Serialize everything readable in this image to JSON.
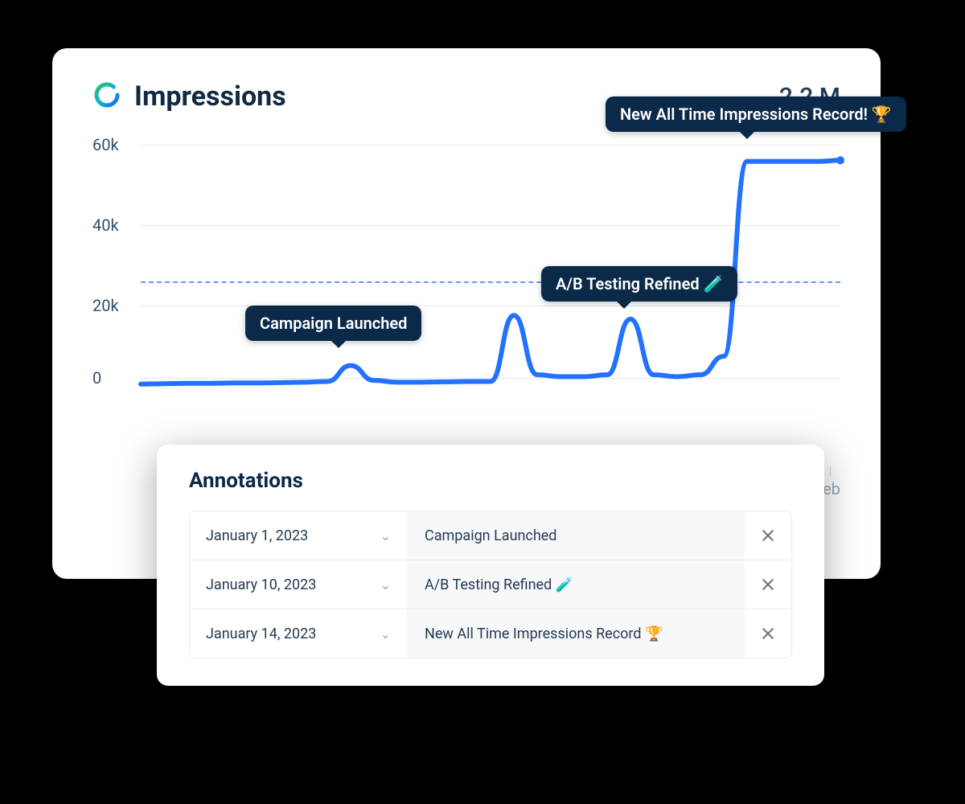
{
  "header": {
    "title": "Impressions",
    "total": "2.2 M"
  },
  "y_ticks": [
    "60k",
    "40k",
    "20k",
    "0"
  ],
  "x_tick": "Feb",
  "badges": {
    "campaign": "Campaign Launched",
    "abtest": "A/B Testing Refined 🧪",
    "record": "New All Time Impressions Record! 🏆"
  },
  "panel": {
    "title": "Annotations",
    "rows": [
      {
        "date": "January 1, 2023",
        "label": "Campaign Launched"
      },
      {
        "date": "January 10, 2023",
        "label": "A/B Testing Refined 🧪"
      },
      {
        "date": "January 14, 2023",
        "label": "New All Time Impressions Record 🏆"
      }
    ]
  },
  "chart_data": {
    "type": "line",
    "title": "Impressions",
    "xlabel": "",
    "ylabel": "Impressions",
    "ylim": [
      0,
      65000
    ],
    "reference_line": 26000,
    "x": [
      0,
      1,
      2,
      3,
      4,
      5,
      6,
      7,
      8,
      9,
      10,
      11,
      12,
      13,
      14,
      15,
      16,
      17,
      18,
      19,
      20,
      21,
      22,
      23,
      24,
      25,
      26,
      27,
      28,
      29,
      30
    ],
    "values": [
      500,
      600,
      700,
      700,
      800,
      800,
      900,
      1000,
      1200,
      5500,
      1500,
      1000,
      1000,
      1100,
      1200,
      1200,
      19000,
      3000,
      2500,
      2500,
      3000,
      18000,
      3000,
      2500,
      3000,
      8000,
      60500,
      60500,
      60500,
      60500,
      60800
    ],
    "annotations": [
      {
        "x": 9,
        "y": 5500,
        "text": "Campaign Launched"
      },
      {
        "x": 21,
        "y": 18000,
        "text": "A/B Testing Refined 🧪"
      },
      {
        "x": 26,
        "y": 60500,
        "text": "New All Time Impressions Record! 🏆"
      }
    ],
    "x_tick_labels": {
      "30": "Feb"
    }
  }
}
